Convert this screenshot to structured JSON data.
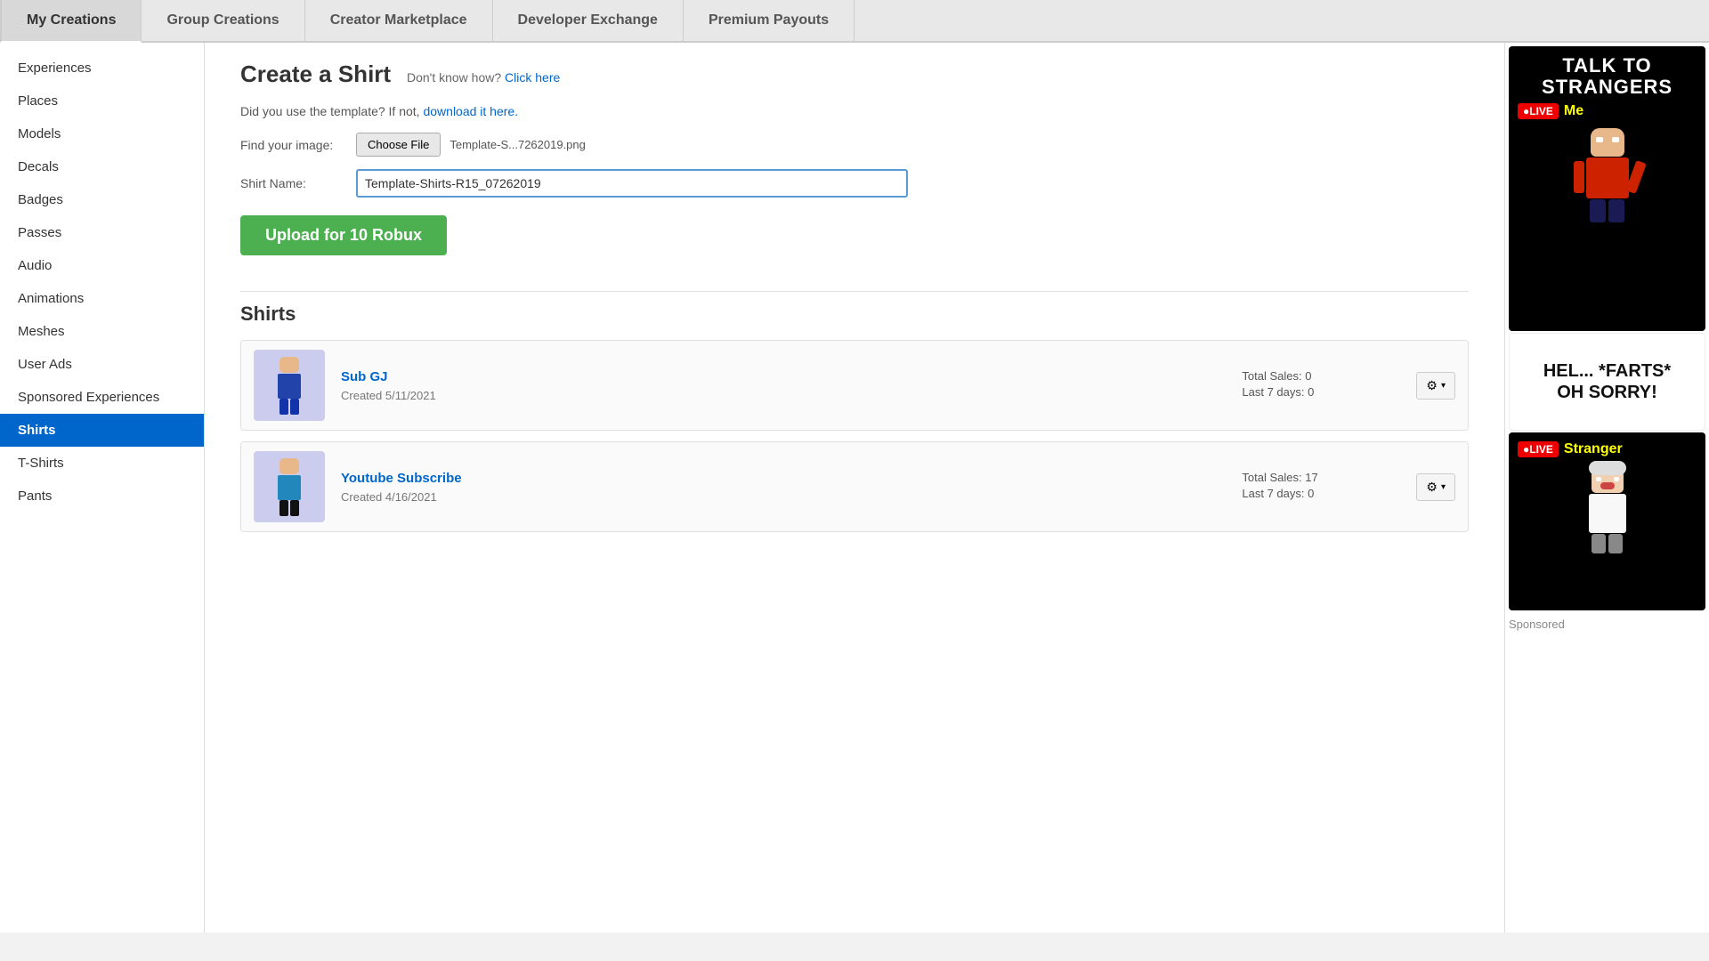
{
  "topNav": {
    "tabs": [
      {
        "id": "my-creations",
        "label": "My Creations",
        "active": true
      },
      {
        "id": "group-creations",
        "label": "Group Creations",
        "active": false
      },
      {
        "id": "creator-marketplace",
        "label": "Creator Marketplace",
        "active": false
      },
      {
        "id": "developer-exchange",
        "label": "Developer Exchange",
        "active": false
      },
      {
        "id": "premium-payouts",
        "label": "Premium Payouts",
        "active": false
      }
    ]
  },
  "sidebar": {
    "items": [
      {
        "id": "experiences",
        "label": "Experiences",
        "active": false
      },
      {
        "id": "places",
        "label": "Places",
        "active": false
      },
      {
        "id": "models",
        "label": "Models",
        "active": false
      },
      {
        "id": "decals",
        "label": "Decals",
        "active": false
      },
      {
        "id": "badges",
        "label": "Badges",
        "active": false
      },
      {
        "id": "passes",
        "label": "Passes",
        "active": false
      },
      {
        "id": "audio",
        "label": "Audio",
        "active": false
      },
      {
        "id": "animations",
        "label": "Animations",
        "active": false
      },
      {
        "id": "meshes",
        "label": "Meshes",
        "active": false
      },
      {
        "id": "user-ads",
        "label": "User Ads",
        "active": false
      },
      {
        "id": "sponsored-experiences",
        "label": "Sponsored Experiences",
        "active": false
      },
      {
        "id": "shirts",
        "label": "Shirts",
        "active": true
      },
      {
        "id": "t-shirts",
        "label": "T-Shirts",
        "active": false
      },
      {
        "id": "pants",
        "label": "Pants",
        "active": false
      }
    ]
  },
  "createShirt": {
    "title": "Create a Shirt",
    "dontKnowText": "Don't know how?",
    "clickHereLabel": "Click here",
    "templateText": "Did you use the template? If not,",
    "downloadLinkText": "download it here.",
    "findImageLabel": "Find your image:",
    "chooseFileLabel": "Choose File",
    "fileNameDisplay": "Template-S...7262019.png",
    "shirtNameLabel": "Shirt Name:",
    "shirtNameValue": "Template-Shirts-R15_07262019",
    "uploadButtonLabel": "Upload for 10 Robux"
  },
  "shirtsSection": {
    "heading": "Shirts",
    "items": [
      {
        "id": "sub-gj",
        "name": "Sub GJ",
        "created": "Created 5/11/2021",
        "totalSales": "Total Sales: 0",
        "last7Days": "Last 7 days: 0",
        "gearLabel": "⚙ ▾"
      },
      {
        "id": "youtube-subscribe",
        "name": "Youtube Subscribe",
        "created": "Created 4/16/2021",
        "totalSales": "Total Sales: 17",
        "last7Days": "Last 7 days: 0",
        "gearLabel": "⚙ ▾"
      }
    ]
  },
  "adSidebar": {
    "panels": [
      {
        "id": "talk-strangers",
        "title": "TALK TO\nSTRANGERS",
        "liveBadge": "●LIVE",
        "liveName": "Me",
        "type": "character-red"
      },
      {
        "id": "farts-panel",
        "text": "HEL... *FARTS*\nOH SORRY!",
        "type": "text-panel"
      },
      {
        "id": "stranger-panel",
        "title": "",
        "liveBadge": "●LIVE",
        "liveName": "Stranger",
        "type": "character-white"
      }
    ],
    "sponsoredLabel": "Sponsored"
  }
}
